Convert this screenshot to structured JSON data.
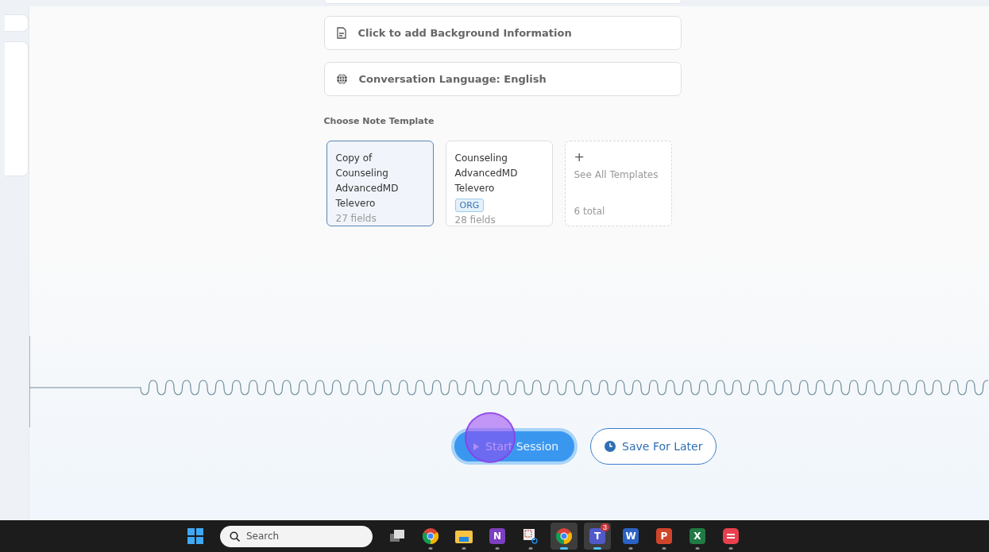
{
  "fields": [
    {
      "kind": "document",
      "text": "Click to add Background Information"
    },
    {
      "kind": "globe",
      "text": "Conversation Language: English"
    }
  ],
  "template_section": {
    "label": "Choose Note Template"
  },
  "templates": [
    {
      "kind": "template",
      "lines": [
        "Copy of",
        "Counseling",
        "AdvancedMD",
        "Televero"
      ],
      "fields": "27 fields",
      "selected": true
    },
    {
      "kind": "template",
      "lines": [
        "Counseling",
        "AdvancedMD",
        "Televero"
      ],
      "badge": "ORG",
      "fields": "28 fields",
      "selected": false
    },
    {
      "kind": "more",
      "plus": "+",
      "title": "See All Templates",
      "total": "6 total",
      "selected": false
    }
  ],
  "actions": [
    {
      "kind": "primary",
      "label": "Start Session"
    },
    {
      "kind": "secondary",
      "label": "Save For Later"
    }
  ],
  "taskbar": {
    "search_placeholder": "Search",
    "apps": [
      {
        "kind": "windows"
      },
      {
        "kind": "taskview"
      },
      {
        "kind": "chrome"
      },
      {
        "kind": "folder"
      },
      {
        "kind": "letter",
        "glyph": "N",
        "color": "#7b3fbf"
      },
      {
        "kind": "snip"
      },
      {
        "kind": "chrome",
        "active": true
      },
      {
        "kind": "letter",
        "glyph": "T",
        "color": "#5059c9",
        "badge": "3",
        "active": true
      },
      {
        "kind": "letter",
        "glyph": "W",
        "color": "#2b62c4"
      },
      {
        "kind": "letter",
        "glyph": "P",
        "color": "#d0452a"
      },
      {
        "kind": "letter",
        "glyph": "X",
        "color": "#1f7a43"
      },
      {
        "kind": "red"
      }
    ]
  }
}
